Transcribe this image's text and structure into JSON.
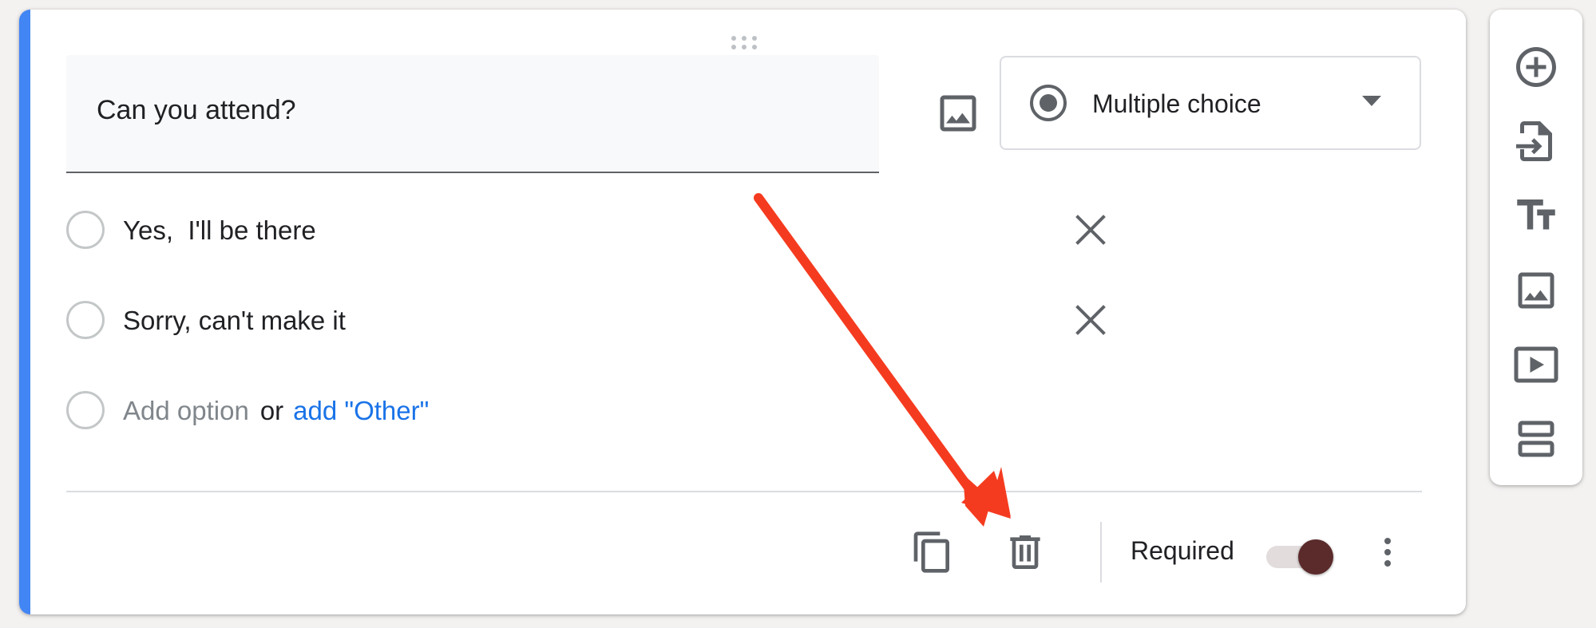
{
  "question": {
    "title": "Can you attend?",
    "type_label": "Multiple choice"
  },
  "options": [
    {
      "label": "Yes,  I'll be there"
    },
    {
      "label": "Sorry, can't make it"
    }
  ],
  "add_option": {
    "placeholder": "Add option",
    "or_text": "or",
    "other_link": "add \"Other\""
  },
  "footer": {
    "required_label": "Required",
    "required_on": true
  },
  "icons": {
    "drag": "drag-handle-icon",
    "image": "image-icon",
    "radio": "radio-button-icon",
    "dropdown": "arrow-drop-down-icon",
    "remove": "close-icon",
    "copy": "content-copy-icon",
    "delete": "trash-icon",
    "more": "more-vert-icon"
  },
  "toolbar": [
    "add-question-icon",
    "import-questions-icon",
    "add-title-icon",
    "add-image-icon",
    "add-video-icon",
    "add-section-icon"
  ],
  "colors": {
    "accent": "#4285f4",
    "link": "#1a73e8",
    "toggle_thumb": "#5b2a2a",
    "annotation_arrow": "#f53b1f"
  }
}
